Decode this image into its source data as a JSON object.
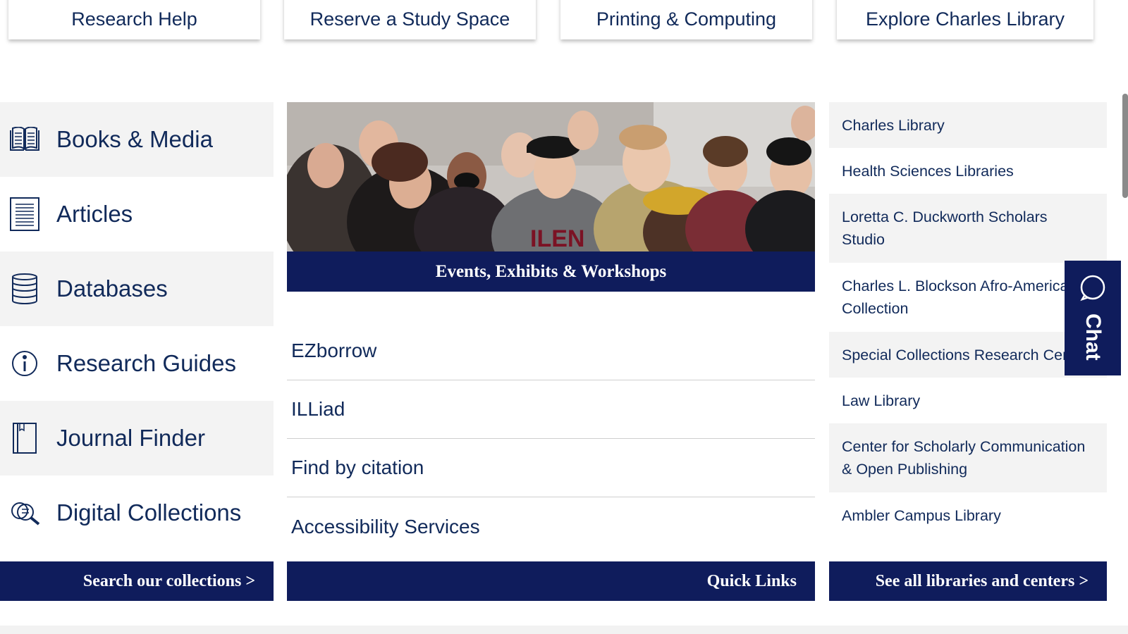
{
  "top_cards": [
    {
      "label": "Research Help"
    },
    {
      "label": "Reserve a Study Space"
    },
    {
      "label": "Printing & Computing"
    },
    {
      "label": "Explore Charles Library"
    }
  ],
  "search_links": [
    {
      "label": "Books & Media",
      "icon": "book-icon"
    },
    {
      "label": "Articles",
      "icon": "document-icon"
    },
    {
      "label": "Databases",
      "icon": "database-icon"
    },
    {
      "label": "Research Guides",
      "icon": "info-icon"
    },
    {
      "label": "Journal Finder",
      "icon": "journal-icon"
    },
    {
      "label": "Digital Collections",
      "icon": "magnifier-icon"
    }
  ],
  "search_button": {
    "label": "Search our collections >"
  },
  "events": {
    "caption": "Events, Exhibits & Workshops"
  },
  "quick_links": [
    {
      "label": "EZborrow"
    },
    {
      "label": "ILLiad"
    },
    {
      "label": "Find by citation"
    },
    {
      "label": "Accessibility Services"
    }
  ],
  "quick_links_button": {
    "label": "Quick Links"
  },
  "libraries": [
    {
      "label": "Charles Library"
    },
    {
      "label": "Health Sciences Libraries"
    },
    {
      "label": "Loretta C. Duckworth Scholars Studio"
    },
    {
      "label": "Charles L. Blockson Afro-American Collection"
    },
    {
      "label": "Special Collections Research Center"
    },
    {
      "label": "Law Library"
    },
    {
      "label": "Center for Scholarly Communication & Open Publishing"
    },
    {
      "label": "Ambler Campus Library"
    }
  ],
  "libraries_button": {
    "label": "See all libraries and centers >"
  },
  "chat": {
    "label": "Chat",
    "icon": "chat-bubble-icon"
  },
  "colors": {
    "navy": "#0f1c5c",
    "text": "#112a5a",
    "shade": "#f3f3f3"
  }
}
